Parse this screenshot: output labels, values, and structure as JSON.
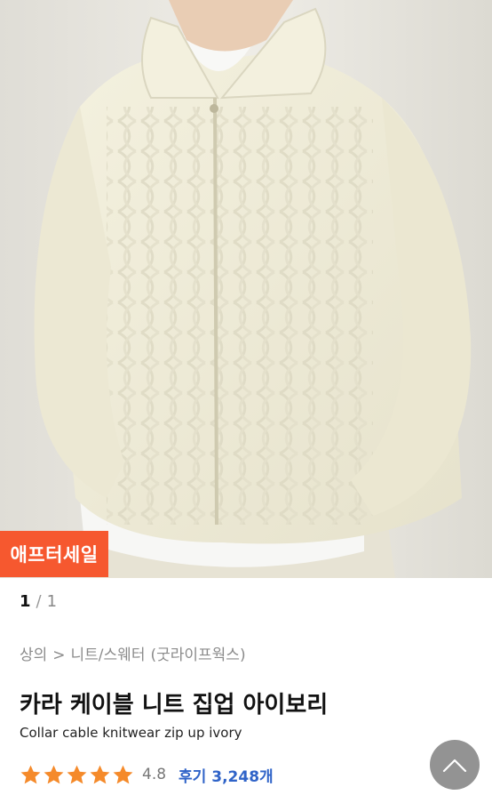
{
  "product": {
    "image_alt": "Collar cable knitwear zip up ivory product photo",
    "badge": "애프터세일",
    "pager": {
      "current": "1",
      "separator": "/",
      "total": "1"
    },
    "breadcrumb": [
      "상의",
      ">",
      "니트/스웨터",
      "(굿라이프웍스)"
    ],
    "title": "카라 케이블 니트 집업 아이보리",
    "subtitle": "Collar cable knitwear zip up ivory",
    "rating": {
      "stars": 5,
      "value": "4.8",
      "reviews": "후기 3,248개"
    }
  },
  "colors": {
    "badge": "#f6582f",
    "star": "#f58a2a",
    "review_link": "#2f63c8",
    "scroll_button": "#8a8a8a"
  },
  "icons": {
    "scroll_top": "chevron-up-icon",
    "star": "star-icon"
  }
}
